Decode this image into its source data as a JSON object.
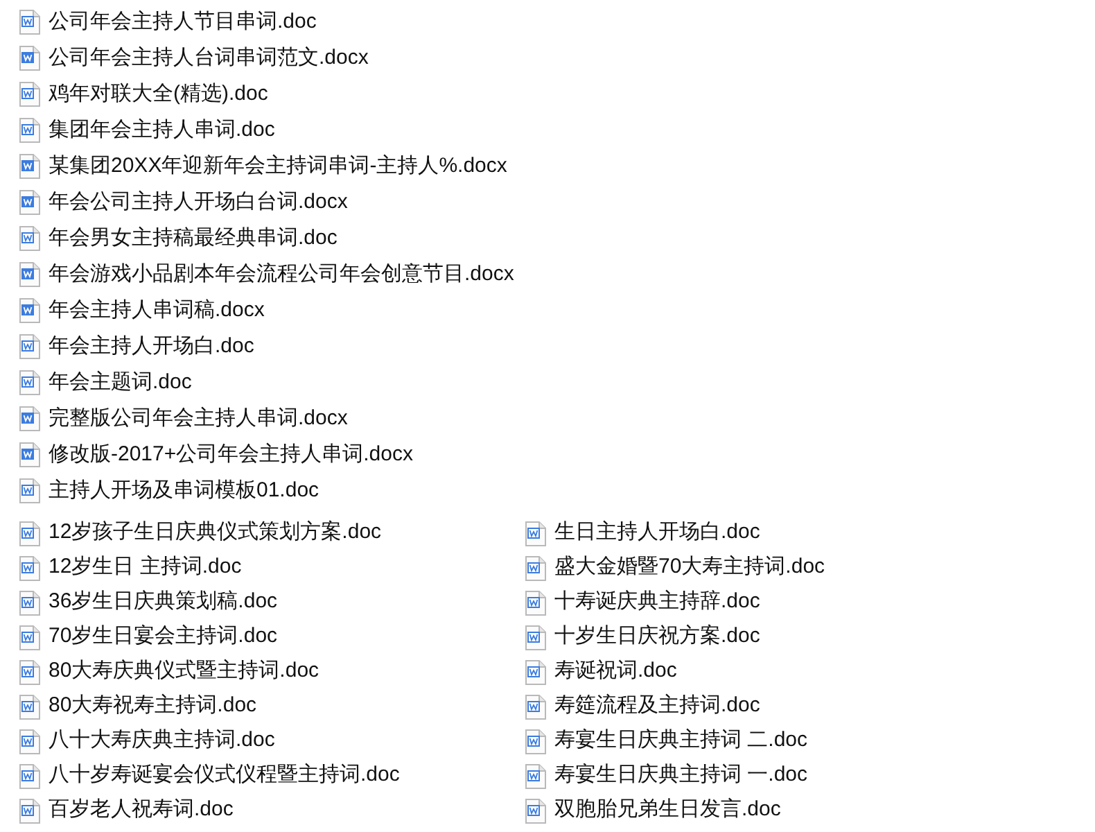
{
  "file_list": [
    {
      "name": "公司年会主持人节目串词.doc",
      "kind": "doc"
    },
    {
      "name": "公司年会主持人台词串词范文.docx",
      "kind": "docx"
    },
    {
      "name": "鸡年对联大全(精选).doc",
      "kind": "doc"
    },
    {
      "name": "集团年会主持人串词.doc",
      "kind": "doc"
    },
    {
      "name": "某集团20XX年迎新年会主持词串词-主持人%.docx",
      "kind": "docx"
    },
    {
      "name": "年会公司主持人开场白台词.docx",
      "kind": "docx"
    },
    {
      "name": "年会男女主持稿最经典串词.doc",
      "kind": "doc"
    },
    {
      "name": "年会游戏小品剧本年会流程公司年会创意节目.docx",
      "kind": "docx"
    },
    {
      "name": "年会主持人串词稿.docx",
      "kind": "docx"
    },
    {
      "name": "年会主持人开场白.doc",
      "kind": "doc"
    },
    {
      "name": "年会主题词.doc",
      "kind": "doc"
    },
    {
      "name": "完整版公司年会主持人串词.docx",
      "kind": "docx"
    },
    {
      "name": "修改版-2017+公司年会主持人串词.docx",
      "kind": "docx"
    },
    {
      "name": "主持人开场及串词模板01.doc",
      "kind": "doc"
    }
  ],
  "file_grid": [
    {
      "name": "12岁孩子生日庆典仪式策划方案.doc",
      "kind": "doc"
    },
    {
      "name": "生日主持人开场白.doc",
      "kind": "doc"
    },
    {
      "name": "12岁生日 主持词.doc",
      "kind": "doc"
    },
    {
      "name": "盛大金婚暨70大寿主持词.doc",
      "kind": "doc"
    },
    {
      "name": "36岁生日庆典策划稿.doc",
      "kind": "doc"
    },
    {
      "name": "十寿诞庆典主持辞.doc",
      "kind": "doc"
    },
    {
      "name": "70岁生日宴会主持词.doc",
      "kind": "doc"
    },
    {
      "name": "十岁生日庆祝方案.doc",
      "kind": "doc"
    },
    {
      "name": "80大寿庆典仪式暨主持词.doc",
      "kind": "doc"
    },
    {
      "name": "寿诞祝词.doc",
      "kind": "doc"
    },
    {
      "name": "80大寿祝寿主持词.doc",
      "kind": "doc"
    },
    {
      "name": "寿筵流程及主持词.doc",
      "kind": "doc"
    },
    {
      "name": "八十大寿庆典主持词.doc",
      "kind": "doc"
    },
    {
      "name": "寿宴生日庆典主持词 二.doc",
      "kind": "doc"
    },
    {
      "name": "八十岁寿诞宴会仪式仪程暨主持词.doc",
      "kind": "doc"
    },
    {
      "name": "寿宴生日庆典主持词 一.doc",
      "kind": "doc"
    },
    {
      "name": "百岁老人祝寿词.doc",
      "kind": "doc"
    },
    {
      "name": "双胞胎兄弟生日发言.doc",
      "kind": "doc"
    }
  ]
}
